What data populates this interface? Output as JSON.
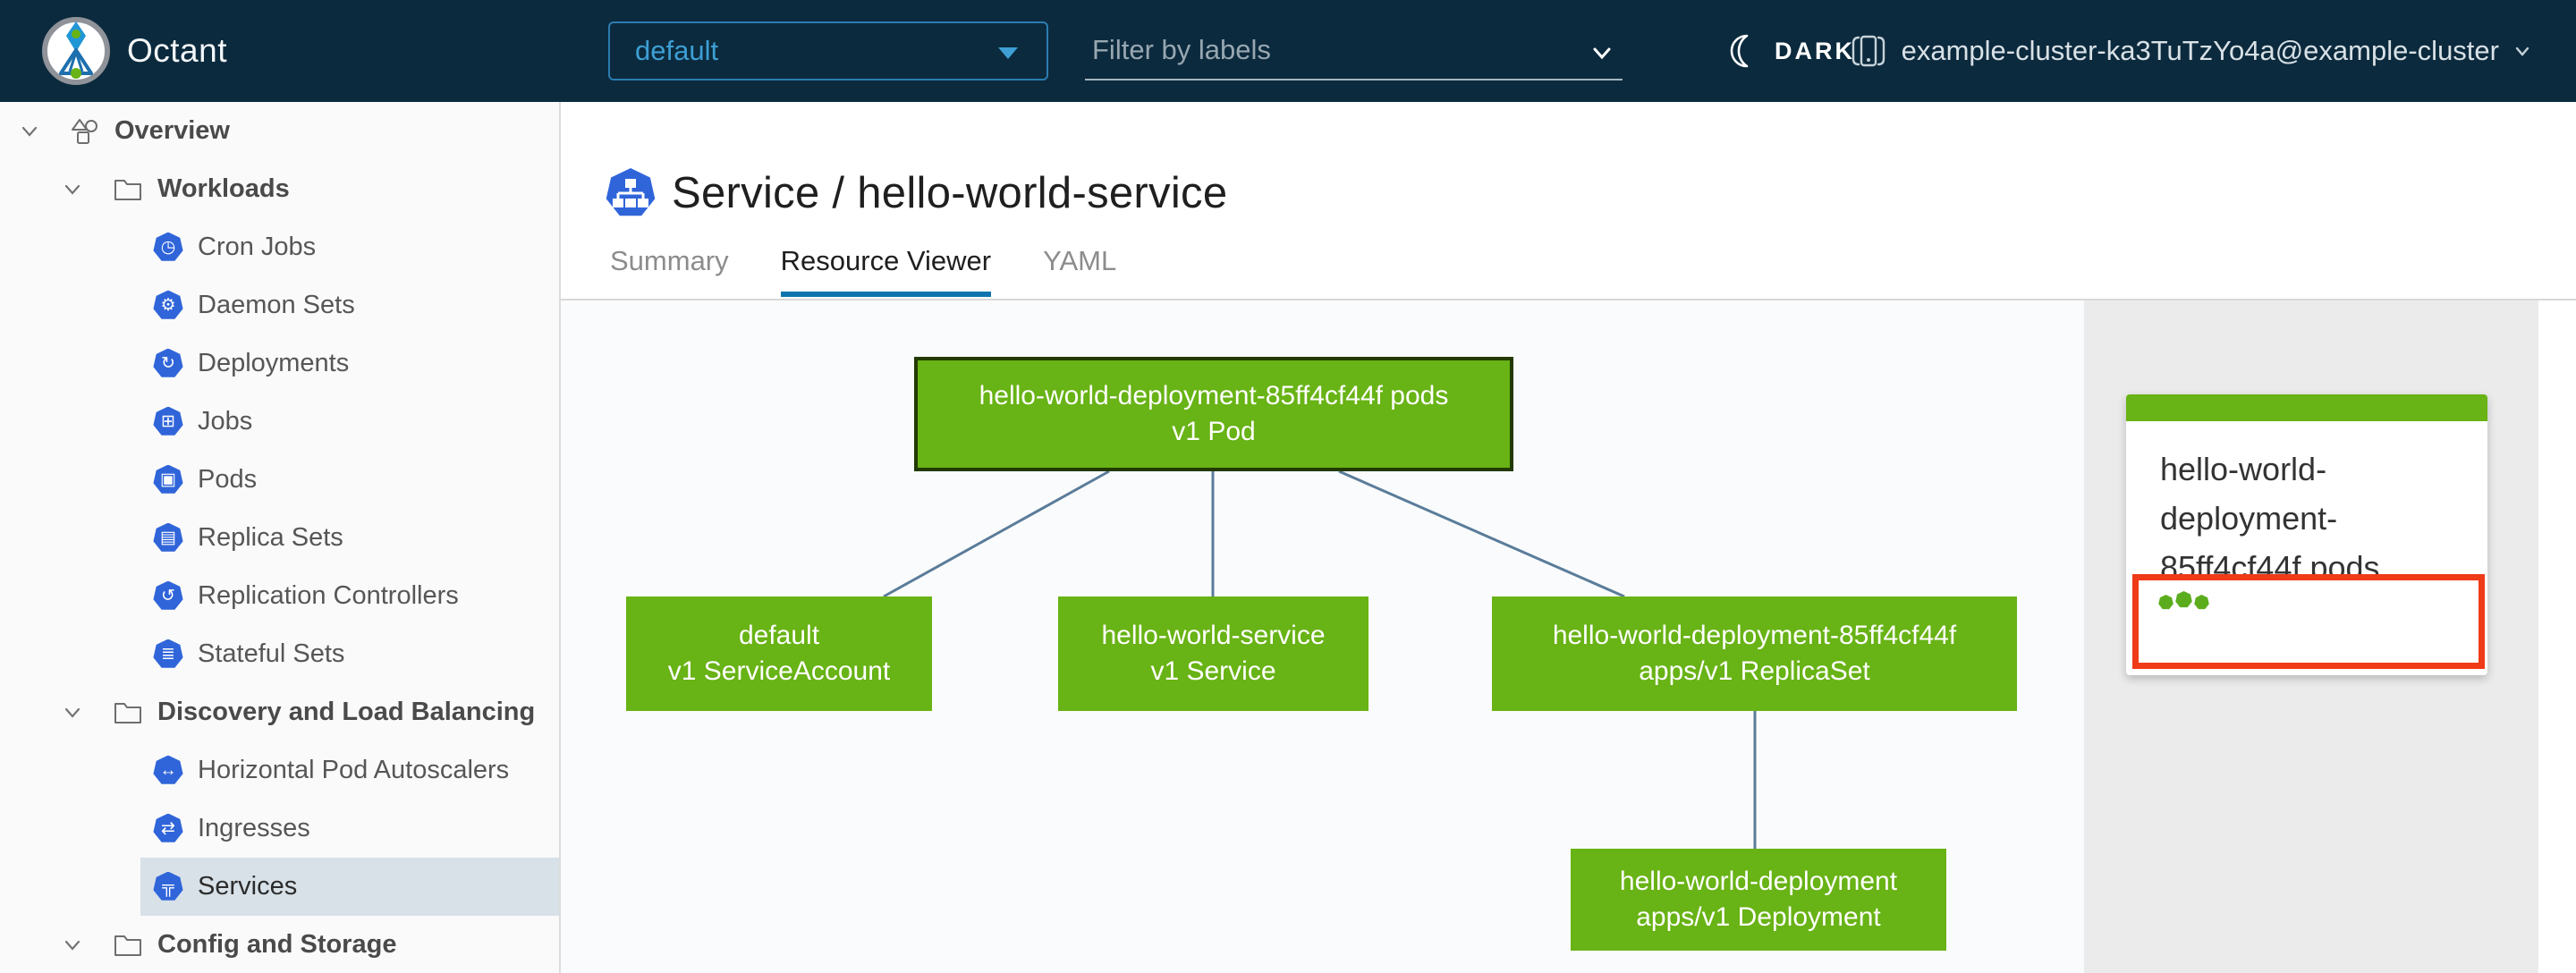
{
  "header": {
    "app_name": "Octant",
    "namespace_selector": {
      "value": "default"
    },
    "label_filter": {
      "placeholder": "Filter by labels"
    },
    "theme_toggle": {
      "label": "DARK",
      "icon": "moon-icon"
    },
    "cluster_context": {
      "value": "example-cluster-ka3TuTzYo4a@example-cluster",
      "icon": "cluster-icon"
    }
  },
  "sidebar": {
    "items": [
      {
        "label": "Overview",
        "depth": 0,
        "icon": "overview-icon",
        "expanded": true,
        "selected": false
      },
      {
        "label": "Workloads",
        "depth": 1,
        "icon": "folder-icon",
        "expanded": true,
        "selected": false
      },
      {
        "label": "Cron Jobs",
        "depth": 2,
        "icon": "cron-jobs-icon",
        "selected": false
      },
      {
        "label": "Daemon Sets",
        "depth": 2,
        "icon": "daemon-sets-icon",
        "selected": false
      },
      {
        "label": "Deployments",
        "depth": 2,
        "icon": "deployments-icon",
        "selected": false
      },
      {
        "label": "Jobs",
        "depth": 2,
        "icon": "jobs-icon",
        "selected": false
      },
      {
        "label": "Pods",
        "depth": 2,
        "icon": "pods-icon",
        "selected": false
      },
      {
        "label": "Replica Sets",
        "depth": 2,
        "icon": "replica-sets-icon",
        "selected": false
      },
      {
        "label": "Replication Controllers",
        "depth": 2,
        "icon": "replication-controllers-icon",
        "selected": false
      },
      {
        "label": "Stateful Sets",
        "depth": 2,
        "icon": "stateful-sets-icon",
        "selected": false
      },
      {
        "label": "Discovery and Load Balancing",
        "depth": 1,
        "icon": "folder-icon",
        "expanded": true,
        "selected": false
      },
      {
        "label": "Horizontal Pod Autoscalers",
        "depth": 2,
        "icon": "hpa-icon",
        "selected": false
      },
      {
        "label": "Ingresses",
        "depth": 2,
        "icon": "ingresses-icon",
        "selected": false
      },
      {
        "label": "Services",
        "depth": 2,
        "icon": "services-icon",
        "selected": true
      },
      {
        "label": "Config and Storage",
        "depth": 1,
        "icon": "folder-icon",
        "expanded": true,
        "selected": false
      }
    ]
  },
  "main": {
    "title": {
      "icon": "service-icon",
      "text": "Service / hello-world-service"
    },
    "tabs": [
      {
        "label": "Summary",
        "active": false
      },
      {
        "label": "Resource Viewer",
        "active": true
      },
      {
        "label": "YAML",
        "active": false
      }
    ]
  },
  "graph": {
    "nodes": [
      {
        "id": "pod",
        "name": "hello-world-deployment-85ff4cf44f pods",
        "kind": "v1 Pod"
      },
      {
        "id": "serviceaccount",
        "name": "default",
        "kind": "v1 ServiceAccount"
      },
      {
        "id": "service",
        "name": "hello-world-service",
        "kind": "v1 Service"
      },
      {
        "id": "replicaset",
        "name": "hello-world-deployment-85ff4cf44f",
        "kind": "apps/v1 ReplicaSet"
      },
      {
        "id": "deployment",
        "name": "hello-world-deployment",
        "kind": "apps/v1 Deployment"
      }
    ],
    "edges": [
      [
        "pod",
        "serviceaccount"
      ],
      [
        "pod",
        "service"
      ],
      [
        "pod",
        "replicaset"
      ],
      [
        "replicaset",
        "deployment"
      ]
    ]
  },
  "detail_panel": {
    "card": {
      "title": "hello-world-deployment-85ff4cf44f pods",
      "status_dots": 3
    }
  },
  "icon_glyphs": {
    "cron-jobs-icon": "◷",
    "daemon-sets-icon": "⚙",
    "deployments-icon": "↻",
    "jobs-icon": "⊞",
    "pods-icon": "▣",
    "replica-sets-icon": "▤",
    "replication-controllers-icon": "↺",
    "stateful-sets-icon": "≣",
    "hpa-icon": "↔",
    "ingresses-icon": "⇄",
    "services-icon": "╦"
  },
  "colors": {
    "header_bg": "#0c2a3d",
    "accent_blue": "#3d9fd4",
    "tab_active_blue": "#0f74ad",
    "node_green": "#68b315",
    "edge_blue": "#5a7c9a",
    "alert_red": "#ef3b17",
    "selected_row_bg": "#d8e1e8",
    "k8s_icon_blue": "#3065da"
  }
}
